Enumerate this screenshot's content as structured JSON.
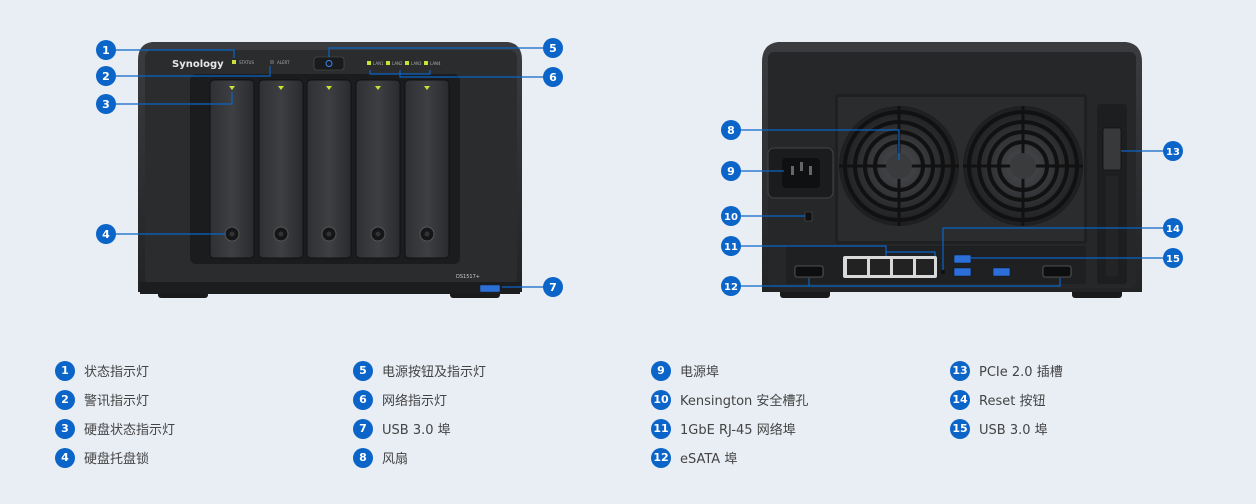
{
  "colors": {
    "accent": "#0b64c7",
    "device_body": "#2b2d2f",
    "background": "#e9eef5"
  },
  "device_front": {
    "brand": "Synology",
    "model": "DS1517+",
    "status_label": "STATUS",
    "alert_label": "ALERT",
    "lan_labels": [
      "LAN1",
      "LAN2",
      "LAN3",
      "LAN4"
    ]
  },
  "callouts": [
    "1",
    "2",
    "3",
    "4",
    "5",
    "6",
    "7",
    "8",
    "9",
    "10",
    "11",
    "12",
    "13",
    "14",
    "15"
  ],
  "legend": [
    [
      {
        "num": "1",
        "label": "状态指示灯"
      },
      {
        "num": "2",
        "label": "警讯指示灯"
      },
      {
        "num": "3",
        "label": "硬盘状态指示灯"
      },
      {
        "num": "4",
        "label": "硬盘托盘锁"
      }
    ],
    [
      {
        "num": "5",
        "label": "电源按钮及指示灯"
      },
      {
        "num": "6",
        "label": "网络指示灯"
      },
      {
        "num": "7",
        "label": "USB 3.0 埠"
      },
      {
        "num": "8",
        "label": "风扇"
      }
    ],
    [
      {
        "num": "9",
        "label": "电源埠"
      },
      {
        "num": "10",
        "label": "Kensington 安全槽孔"
      },
      {
        "num": "11",
        "label": "1GbE RJ-45 网络埠"
      },
      {
        "num": "12",
        "label": "eSATA 埠"
      }
    ],
    [
      {
        "num": "13",
        "label": "PCIe 2.0 插槽"
      },
      {
        "num": "14",
        "label": "Reset 按钮"
      },
      {
        "num": "15",
        "label": "USB 3.0 埠"
      }
    ]
  ]
}
